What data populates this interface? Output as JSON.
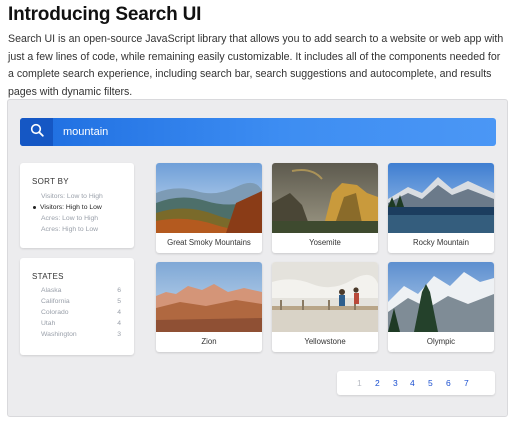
{
  "title": "Introducing Search UI",
  "intro": "Search UI is an open-source JavaScript library that allows you to add search to a website or web app with just a few lines of code, while remaining easily customizable. It includes all of the components needed for a complete search experience, including search bar, search suggestions and autocomplete, and results pages with dynamic filters.",
  "search": {
    "value": "mountain",
    "icon": "search-icon"
  },
  "sort_by": {
    "title": "SORT BY",
    "options": [
      {
        "label": "Visitors: Low to High",
        "selected": false
      },
      {
        "label": "Visitors: High to Low",
        "selected": true
      },
      {
        "label": "Acres: Low to High",
        "selected": false
      },
      {
        "label": "Acres: High to Low",
        "selected": false
      }
    ]
  },
  "states": {
    "title": "STATES",
    "items": [
      {
        "name": "Alaska",
        "count": "6"
      },
      {
        "name": "California",
        "count": "5"
      },
      {
        "name": "Colorado",
        "count": "4"
      },
      {
        "name": "Utah",
        "count": "4"
      },
      {
        "name": "Washington",
        "count": "3"
      }
    ]
  },
  "results": [
    {
      "name": "Great Smoky Mountains"
    },
    {
      "name": "Yosemite"
    },
    {
      "name": "Rocky Mountain"
    },
    {
      "name": "Zion"
    },
    {
      "name": "Yellowstone"
    },
    {
      "name": "Olympic"
    }
  ],
  "pagination": {
    "current": "1",
    "pages": [
      "1",
      "2",
      "3",
      "4",
      "5",
      "6",
      "7"
    ]
  },
  "colors": {
    "accent": "#1d6de0",
    "search_button": "#1557c4",
    "link": "#1a4fd0"
  }
}
